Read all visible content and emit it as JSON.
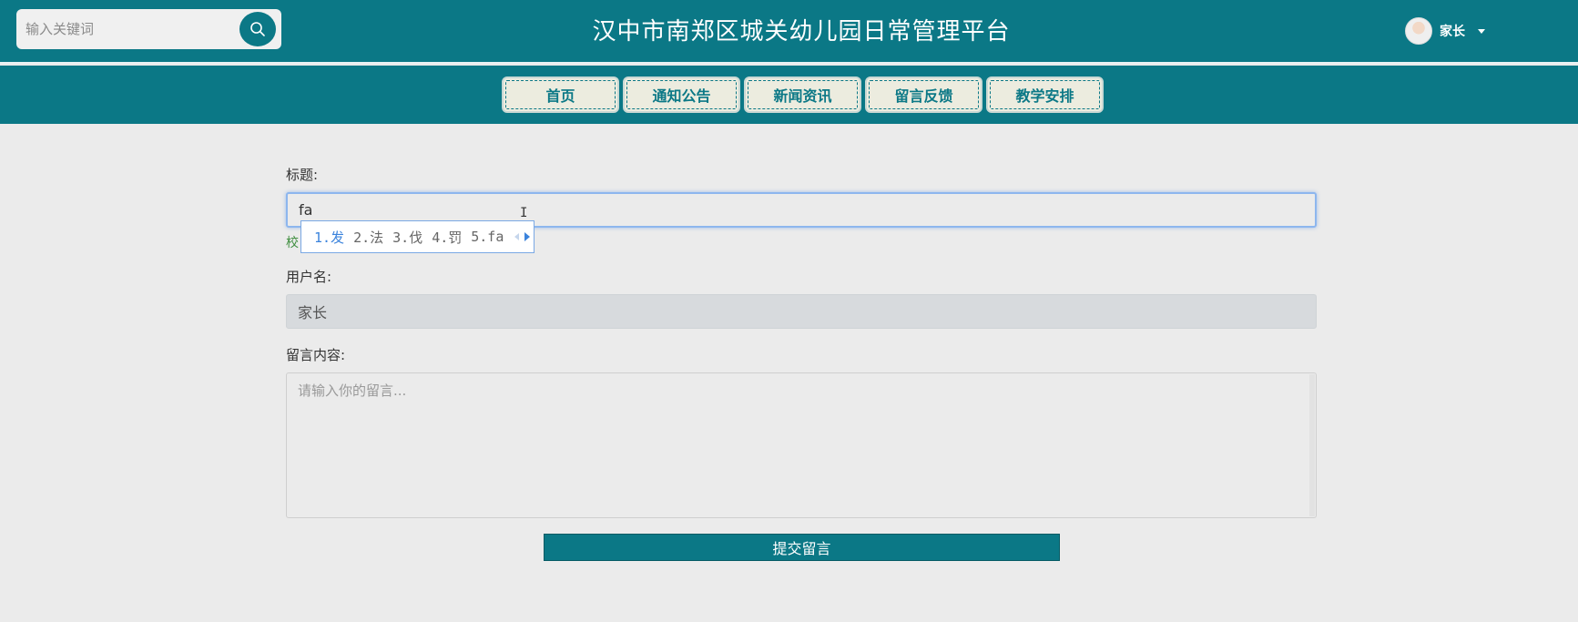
{
  "header": {
    "search_placeholder": "输入关键词",
    "site_title": "汉中市南郑区城关幼儿园日常管理平台",
    "user_name": "家长"
  },
  "nav": {
    "items": [
      {
        "label": "首页"
      },
      {
        "label": "通知公告"
      },
      {
        "label": "新闻资讯"
      },
      {
        "label": "留言反馈"
      },
      {
        "label": "教学安排"
      }
    ]
  },
  "form": {
    "title_label": "标题:",
    "title_value": "fa",
    "hint_text": "校",
    "username_label": "用户名:",
    "username_value": "家长",
    "content_label": "留言内容:",
    "content_placeholder": "请输入你的留言...",
    "submit_label": "提交留言"
  },
  "ime": {
    "candidates": [
      "1.发",
      "2.法",
      "3.伐",
      "4.罚",
      "5.fa"
    ]
  },
  "colors": {
    "brand": "#0b7886",
    "background": "#ebebeb",
    "nav_button_bg": "#ececdf",
    "ime_selected": "#3b83dc"
  },
  "icons": {
    "search": "search-icon",
    "dropdown": "chevron-down-icon"
  }
}
